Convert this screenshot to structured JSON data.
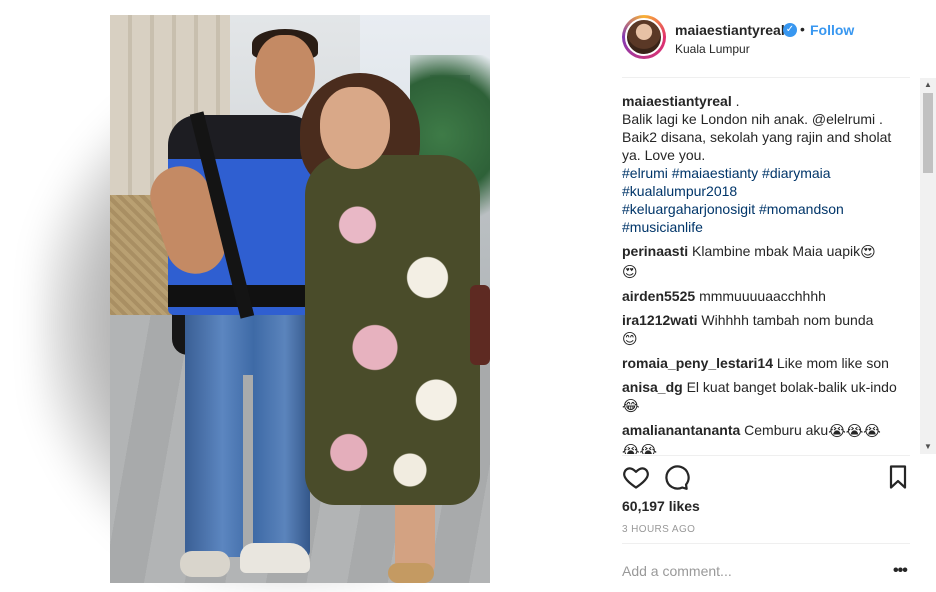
{
  "post": {
    "username": "maiaestiantyreal",
    "verified_mark": "✓",
    "separator": "•",
    "follow_label": "Follow",
    "location": "Kuala Lumpur"
  },
  "caption": {
    "username": "maiaestiantyreal",
    "lines": [
      ".",
      "Balik lagi ke London nih anak. @elelrumi .",
      "Baik2 disana, sekolah yang rajin and sholat",
      "ya. Love you."
    ],
    "hashtags": [
      "#elrumi #maiaestianty #diarymaia",
      "#kualalumpur2018",
      "#keluargaharjonosigit #momandson",
      "#musicianlife"
    ]
  },
  "comments": [
    {
      "user": "perinaasti",
      "text": "Klambine mbak Maia uapik",
      "emoji": [
        "heart-eyes",
        "heart-eyes"
      ]
    },
    {
      "user": "airden5525",
      "text": "mmmuuuuaacchhhh",
      "emoji": []
    },
    {
      "user": "ira1212wati",
      "text": "Wihhhh tambah nom bunda",
      "emoji": [
        "smile"
      ]
    },
    {
      "user": "romaia_peny_lestari14",
      "text": "Like mom like son",
      "emoji": []
    },
    {
      "user": "anisa_dg",
      "text": "El kuat banget bolak-balik uk-indo",
      "emoji": [
        "tears-of-joy"
      ]
    },
    {
      "user": "amalianantananta",
      "text": "Cemburu aku",
      "emoji": [
        "crying",
        "crying",
        "crying",
        "crying",
        "crying"
      ]
    }
  ],
  "actions": {
    "like_icon": "heart-outline",
    "comment_icon": "speech-bubble",
    "save_icon": "bookmark"
  },
  "likes": "60,197 likes",
  "time": "3 HOURS AGO",
  "comment_input": {
    "placeholder": "Add a comment...",
    "more_label": "•••"
  },
  "scrollbar": {
    "up": "▲",
    "down": "▼"
  },
  "colors": {
    "link": "#003569",
    "follow": "#3897f0",
    "muted": "#999999",
    "divider": "#efefef"
  }
}
